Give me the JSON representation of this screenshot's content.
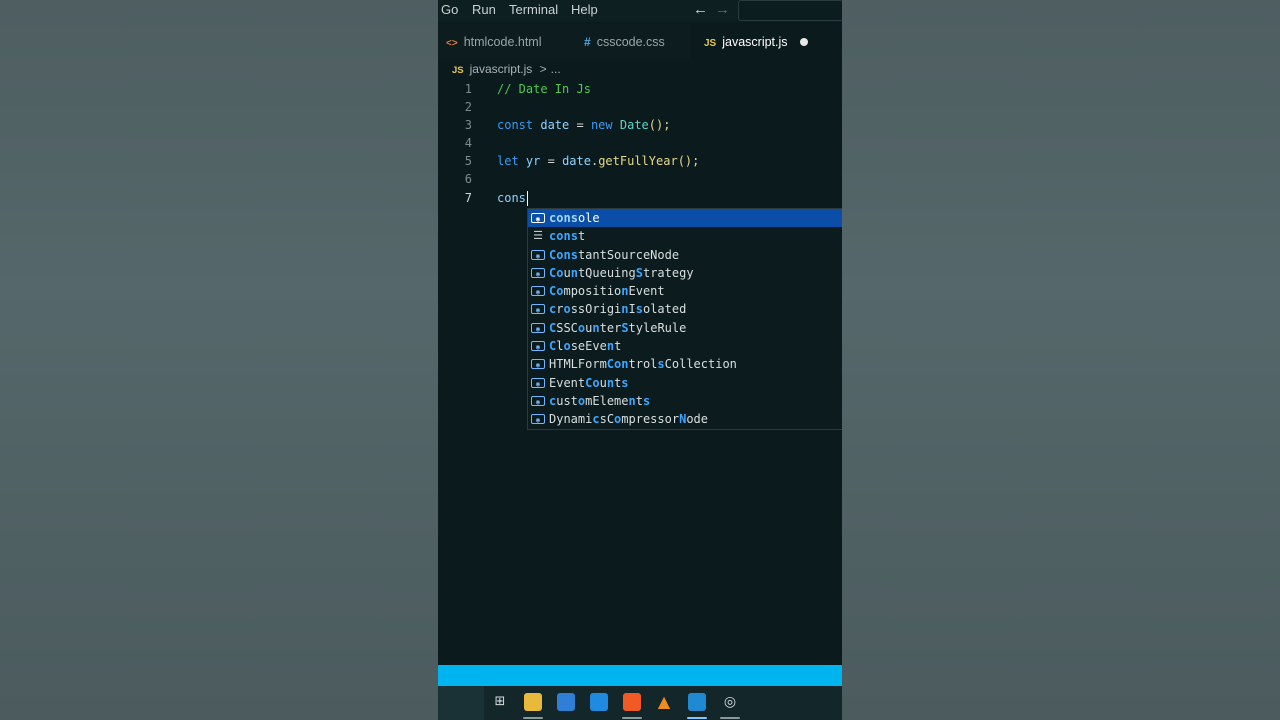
{
  "menubar": {
    "items": [
      "Go",
      "Run",
      "Terminal",
      "Help"
    ],
    "back_arrow": "←",
    "forward_arrow": "→"
  },
  "tabs": [
    {
      "icon": "<>",
      "label": "htmlcode.html",
      "active": false
    },
    {
      "icon": "#",
      "label": "csscode.css",
      "active": false
    },
    {
      "icon": "JS",
      "label": "javascript.js",
      "active": true,
      "modified": true
    }
  ],
  "breadcrumb": {
    "icon": "JS",
    "file": "javascript.js",
    "separator": ">",
    "more": "..."
  },
  "code_lines": [
    {
      "number": "1",
      "text": "// Date In Js"
    },
    {
      "number": "2",
      "text": ""
    },
    {
      "number": "3",
      "text": "const date = new Date();"
    },
    {
      "number": "4",
      "text": ""
    },
    {
      "number": "5",
      "text": "let yr = date.getFullYear();"
    },
    {
      "number": "6",
      "text": ""
    },
    {
      "number": "7",
      "text": "cons"
    }
  ],
  "suggestions": [
    {
      "label": "console",
      "kind": "variable",
      "selected": true
    },
    {
      "label": "const",
      "kind": "keyword",
      "selected": false
    },
    {
      "label": "ConstantSourceNode",
      "kind": "variable",
      "selected": false
    },
    {
      "label": "CountQueuingStrategy",
      "kind": "variable",
      "selected": false
    },
    {
      "label": "CompositionEvent",
      "kind": "variable",
      "selected": false
    },
    {
      "label": "crossOriginIsolated",
      "kind": "variable",
      "selected": false
    },
    {
      "label": "CSSCounterStyleRule",
      "kind": "variable",
      "selected": false
    },
    {
      "label": "CloseEvent",
      "kind": "variable",
      "selected": false
    },
    {
      "label": "HTMLFormControlsCollection",
      "kind": "variable",
      "selected": false
    },
    {
      "label": "EventCounts",
      "kind": "variable",
      "selected": false
    },
    {
      "label": "customElements",
      "kind": "variable",
      "selected": false
    },
    {
      "label": "DynamicsCompressorNode",
      "kind": "variable",
      "selected": false
    }
  ],
  "colors": {
    "accent": "#00b4f0",
    "selection": "#0a4ea8",
    "editor_bg": "#0a1a1d"
  },
  "taskbar_icons": [
    "task-view-icon",
    "file-explorer-icon",
    "store-icon",
    "mail-icon",
    "brave-browser-icon",
    "vlc-icon",
    "vscode-icon",
    "settings-icon"
  ]
}
